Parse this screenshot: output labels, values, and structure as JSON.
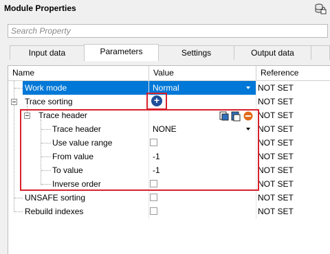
{
  "window": {
    "title": "Module Properties"
  },
  "search": {
    "placeholder": "Search Property"
  },
  "tabs": [
    {
      "label": "Input data"
    },
    {
      "label": "Parameters"
    },
    {
      "label": "Settings"
    },
    {
      "label": "Output data"
    }
  ],
  "table": {
    "headers": {
      "name": "Name",
      "value": "Value",
      "reference": "Reference"
    },
    "rows": [
      {
        "name": "Work mode",
        "value": "Normal",
        "reference": "NOT SET"
      },
      {
        "name": "Trace sorting",
        "value": "",
        "reference": "NOT SET"
      },
      {
        "name": "Trace header",
        "value": "",
        "reference": "NOT SET"
      },
      {
        "name": "Trace header",
        "value": "NONE",
        "reference": "NOT SET"
      },
      {
        "name": "Use value range",
        "value": "",
        "reference": "NOT SET"
      },
      {
        "name": "From value",
        "value": "-1",
        "reference": "NOT SET"
      },
      {
        "name": "To value",
        "value": "-1",
        "reference": "NOT SET"
      },
      {
        "name": "Inverse order",
        "value": "",
        "reference": "NOT SET"
      },
      {
        "name": "UNSAFE sorting",
        "value": "",
        "reference": "NOT SET"
      },
      {
        "name": "Rebuild indexes",
        "value": "",
        "reference": "NOT SET"
      }
    ]
  },
  "checkboxes": {
    "use_value_range": false,
    "inverse_order": false,
    "unsafe_sorting": false,
    "rebuild_indexes": false
  },
  "icons": {
    "database": "database-icon",
    "add": "plus-circle-icon",
    "header_actions": [
      "copy-icon",
      "paste-icon",
      "remove-icon"
    ]
  },
  "colors": {
    "selection": "#0078d7",
    "highlight_box": "#d8202c",
    "add_button": "#1f4e9a",
    "remove_button": "#e06a1a"
  }
}
